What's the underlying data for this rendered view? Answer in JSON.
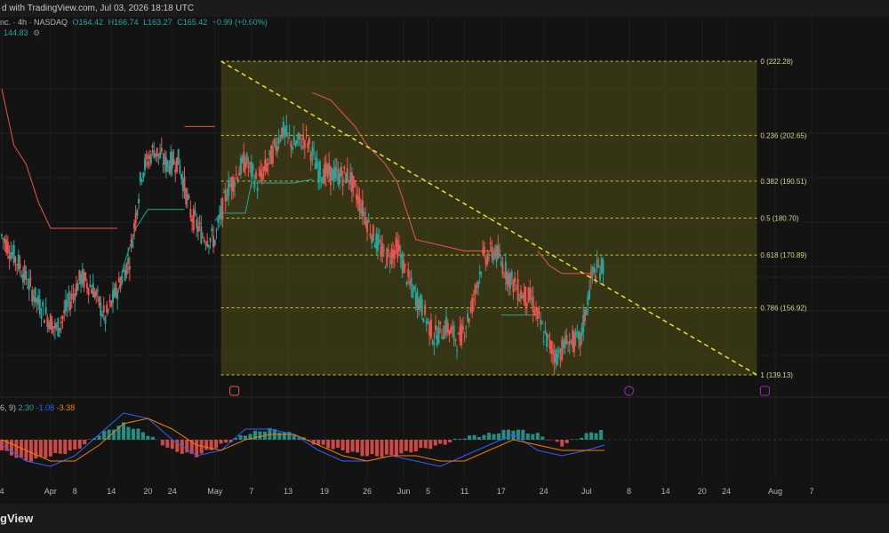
{
  "topbar": {
    "text": "d with TradingView.com, Jul 03, 2026 18:18 UTC"
  },
  "legend": {
    "symbol": "nc. · 4h · NASDAQ",
    "open": "O164.42",
    "high": "H166.74",
    "low": "L163.27",
    "close": "C165.42",
    "change": "+0.99 (+0.60%)",
    "indicator_value": "144.83"
  },
  "macd_legend": {
    "params": "6, 9)",
    "macd": "2.30",
    "signal": "-1.08",
    "hist": "-3.38"
  },
  "brand": "gView",
  "colors": {
    "up": "#26a69a",
    "down": "#ef5350",
    "fib": "#c8c832",
    "macd": "#2962ff",
    "signal": "#f57c00"
  },
  "chart_data": {
    "type": "candlestick",
    "price_axis_labels_printed": false,
    "fib_retracement": {
      "levels": [
        {
          "ratio": "0",
          "price": 222.28,
          "label": "0 (222.28)"
        },
        {
          "ratio": "0.236",
          "price": 202.65,
          "label": "0.236 (202.65)"
        },
        {
          "ratio": "0.382",
          "price": 190.51,
          "label": "0.382 (190.51)"
        },
        {
          "ratio": "0.5",
          "price": 180.7,
          "label": "0.5 (180.70)"
        },
        {
          "ratio": "0.618",
          "price": 170.89,
          "label": "0.618 (170.89)"
        },
        {
          "ratio": "0.786",
          "price": 156.92,
          "label": "0.786 (156.92)"
        },
        {
          "ratio": "1",
          "price": 139.13,
          "label": "1 (139.13)"
        }
      ],
      "start_day": 36,
      "end_day": 124
    },
    "trendline": {
      "from": {
        "day": 36,
        "price": 222.28
      },
      "to": {
        "day": 124,
        "price": 139.13
      }
    },
    "x_ticks": [
      {
        "label": "4",
        "day": 0
      },
      {
        "label": "Apr",
        "day": 8
      },
      {
        "label": "8",
        "day": 12
      },
      {
        "label": "14",
        "day": 18
      },
      {
        "label": "20",
        "day": 24
      },
      {
        "label": "24",
        "day": 28
      },
      {
        "label": "May",
        "day": 35
      },
      {
        "label": "7",
        "day": 41
      },
      {
        "label": "13",
        "day": 47
      },
      {
        "label": "19",
        "day": 53
      },
      {
        "label": "26",
        "day": 60
      },
      {
        "label": "Jun",
        "day": 66
      },
      {
        "label": "5",
        "day": 70
      },
      {
        "label": "11",
        "day": 76
      },
      {
        "label": "17",
        "day": 82
      },
      {
        "label": "24",
        "day": 89
      },
      {
        "label": "Jul",
        "day": 96
      },
      {
        "label": "8",
        "day": 103
      },
      {
        "label": "14",
        "day": 109
      },
      {
        "label": "20",
        "day": 115
      },
      {
        "label": "24",
        "day": 119
      },
      {
        "label": "Aug",
        "day": 127
      },
      {
        "label": "7",
        "day": 133
      }
    ],
    "price_path": [
      [
        0,
        176
      ],
      [
        3,
        168
      ],
      [
        6,
        158
      ],
      [
        9,
        151
      ],
      [
        11,
        158
      ],
      [
        13,
        165
      ],
      [
        15,
        162
      ],
      [
        17,
        154
      ],
      [
        19,
        162
      ],
      [
        21,
        170
      ],
      [
        23,
        193
      ],
      [
        25,
        199
      ],
      [
        27,
        195
      ],
      [
        29,
        196
      ],
      [
        31,
        182
      ],
      [
        33,
        176
      ],
      [
        35,
        175
      ],
      [
        37,
        188
      ],
      [
        40,
        196
      ],
      [
        42,
        190
      ],
      [
        44,
        196
      ],
      [
        46,
        204
      ],
      [
        48,
        200
      ],
      [
        50,
        202
      ],
      [
        52,
        193
      ],
      [
        55,
        192
      ],
      [
        57,
        192
      ],
      [
        59,
        184
      ],
      [
        61,
        176
      ],
      [
        63,
        170
      ],
      [
        65,
        173
      ],
      [
        67,
        163
      ],
      [
        69,
        157
      ],
      [
        71,
        149
      ],
      [
        73,
        152
      ],
      [
        75,
        148
      ],
      [
        77,
        156
      ],
      [
        79,
        170
      ],
      [
        81,
        172
      ],
      [
        83,
        166
      ],
      [
        85,
        161
      ],
      [
        87,
        159
      ],
      [
        89,
        150
      ],
      [
        91,
        144
      ],
      [
        93,
        148
      ],
      [
        95,
        148
      ],
      [
        97,
        166
      ],
      [
        99,
        168
      ]
    ],
    "supertrend": {
      "segments": [
        {
          "trend": "down",
          "points": [
            [
              0,
              215
            ],
            [
              2,
              200
            ],
            [
              4,
              195
            ],
            [
              6,
              185
            ],
            [
              8,
              178
            ],
            [
              13,
              178
            ],
            [
              19,
              178
            ]
          ]
        },
        {
          "trend": "up",
          "points": [
            [
              19,
              160
            ],
            [
              20,
              168
            ],
            [
              22,
              178
            ],
            [
              24,
              183
            ],
            [
              30,
              183
            ],
            [
              30,
              183
            ]
          ]
        },
        {
          "trend": "down",
          "points": [
            [
              30,
              205
            ],
            [
              33,
              205
            ],
            [
              35,
              205
            ]
          ]
        },
        {
          "trend": "up",
          "points": [
            [
              35,
              180
            ],
            [
              36,
              182
            ],
            [
              40,
              182
            ],
            [
              41,
              190
            ],
            [
              48,
              190
            ],
            [
              51,
              191
            ]
          ]
        },
        {
          "trend": "down",
          "points": [
            [
              51,
              214
            ],
            [
              54,
              212
            ],
            [
              58,
              205
            ],
            [
              60,
              200
            ],
            [
              63,
              195
            ],
            [
              65,
              190
            ],
            [
              68,
              175
            ],
            [
              76,
              172
            ],
            [
              82,
              172
            ]
          ]
        },
        {
          "trend": "up",
          "points": [
            [
              82,
              155
            ],
            [
              88,
              155
            ]
          ]
        },
        {
          "trend": "down",
          "points": [
            [
              88,
              172
            ],
            [
              90,
              168
            ],
            [
              92,
              166
            ],
            [
              97,
              166
            ]
          ]
        }
      ]
    },
    "macd": {
      "hist_path": [
        [
          0,
          -2
        ],
        [
          4,
          -4
        ],
        [
          8,
          -3
        ],
        [
          12,
          -2
        ],
        [
          16,
          1
        ],
        [
          20,
          3
        ],
        [
          24,
          1
        ],
        [
          28,
          -2
        ],
        [
          32,
          -3
        ],
        [
          36,
          -1
        ],
        [
          40,
          1
        ],
        [
          44,
          2
        ],
        [
          48,
          1
        ],
        [
          52,
          -1
        ],
        [
          56,
          -2
        ],
        [
          60,
          -3
        ],
        [
          64,
          -3
        ],
        [
          68,
          -2
        ],
        [
          72,
          -1
        ],
        [
          76,
          0.5
        ],
        [
          80,
          1
        ],
        [
          84,
          2
        ],
        [
          88,
          1
        ],
        [
          92,
          -1
        ],
        [
          96,
          1
        ],
        [
          99,
          2
        ]
      ],
      "macd_path": [
        [
          0,
          -1
        ],
        [
          4,
          -4
        ],
        [
          8,
          -5
        ],
        [
          12,
          -3
        ],
        [
          16,
          1
        ],
        [
          20,
          5
        ],
        [
          24,
          4
        ],
        [
          28,
          0
        ],
        [
          32,
          -3
        ],
        [
          36,
          -2
        ],
        [
          40,
          2
        ],
        [
          44,
          2
        ],
        [
          48,
          1
        ],
        [
          52,
          -2
        ],
        [
          56,
          -4
        ],
        [
          60,
          -4
        ],
        [
          64,
          -3
        ],
        [
          68,
          -4
        ],
        [
          72,
          -5
        ],
        [
          76,
          -3
        ],
        [
          80,
          -1
        ],
        [
          84,
          1
        ],
        [
          88,
          -2
        ],
        [
          92,
          -3
        ],
        [
          96,
          -2
        ],
        [
          99,
          -1
        ]
      ],
      "signal_path": [
        [
          0,
          0
        ],
        [
          4,
          -2
        ],
        [
          8,
          -4
        ],
        [
          12,
          -4
        ],
        [
          16,
          -1
        ],
        [
          20,
          3
        ],
        [
          24,
          4
        ],
        [
          28,
          2
        ],
        [
          32,
          -1
        ],
        [
          36,
          -2
        ],
        [
          40,
          0
        ],
        [
          44,
          1
        ],
        [
          48,
          1
        ],
        [
          52,
          -1
        ],
        [
          56,
          -3
        ],
        [
          60,
          -4
        ],
        [
          64,
          -3
        ],
        [
          68,
          -3
        ],
        [
          72,
          -4
        ],
        [
          76,
          -4
        ],
        [
          80,
          -2
        ],
        [
          84,
          0
        ],
        [
          88,
          -1
        ],
        [
          92,
          -2
        ],
        [
          96,
          -2
        ],
        [
          99,
          -2
        ]
      ]
    }
  }
}
